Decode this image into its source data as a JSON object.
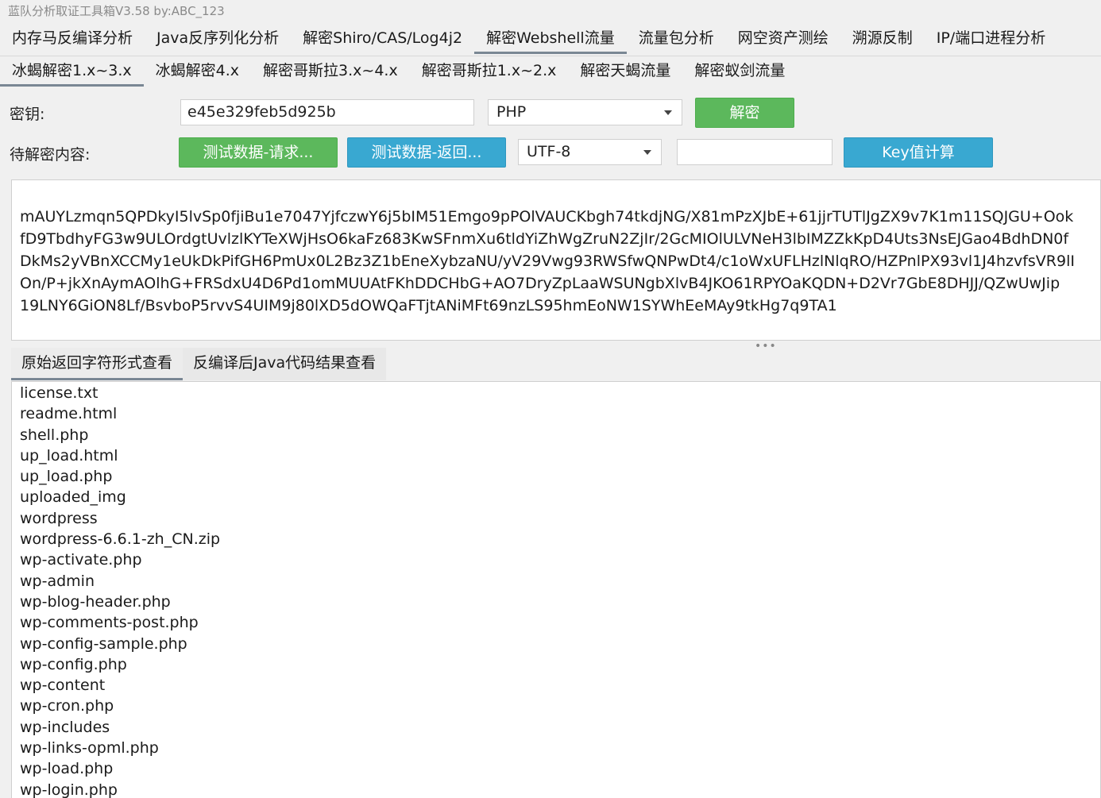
{
  "window": {
    "title": "蓝队分析取证工具箱V3.58 by:ABC_123"
  },
  "main_tabs": [
    {
      "label": "内存马反编译分析"
    },
    {
      "label": "Java反序列化分析"
    },
    {
      "label": "解密Shiro/CAS/Log4j2"
    },
    {
      "label": "解密Webshell流量",
      "active": true
    },
    {
      "label": "流量包分析"
    },
    {
      "label": "网空资产测绘"
    },
    {
      "label": "溯源反制"
    },
    {
      "label": "IP/端口进程分析"
    }
  ],
  "sub_tabs": [
    {
      "label": "冰蝎解密1.x~3.x",
      "active": true
    },
    {
      "label": "冰蝎解密4.x"
    },
    {
      "label": "解密哥斯拉3.x~4.x"
    },
    {
      "label": "解密哥斯拉1.x~2.x"
    },
    {
      "label": "解密天蝎流量"
    },
    {
      "label": "解密蚁剑流量"
    }
  ],
  "form": {
    "key_label": "密钥:",
    "key_value": "e45e329feb5d925b",
    "lang_select": "PHP",
    "decrypt_button": "解密",
    "content_label": "待解密内容:",
    "test_request_button": "测试数据-请求...",
    "test_response_button": "测试数据-返回...",
    "encoding_select": "UTF-8",
    "extra_input": "",
    "key_calc_button": "Key值计算"
  },
  "ciphertext": [
    "mAUYLzmqn5QPDkyI5lvSp0fjiBu1e7047YjfczwY6j5bIM51Emgo9pPOlVAUCKbgh74tkdjNG/X81mPzXJbE+61jjrTUTlJgZX9v7K1m11SQJGU+Ook",
    "fD9TbdhyFG3w9ULOrdgtUvlzlKYTeXWjHsO6kaFz683KwSFnmXu6tldYiZhWgZruN2ZjIr/2GcMIOlULVNeH3lbIMZZkKpD4Uts3NsEJGao4BdhDN0f",
    "DkMs2yVBnXCCMy1eUkDkPifGH6PmUx0L2Bz3Z1bEneXybzaNU/yV29Vwg93RWSfwQNPwDt4/c1oWxUFLHzlNlqRO/HZPnlPX93vl1J4hzvfsVR9lI",
    "On/P+jkXnAymAOlhG+FRSdxU4D6Pd1omMUUAtFKhDDCHbG+AO7DryZpLaaWSUNgbXlvB4JKO61RPYOaKQDN+D2Vr7GbE8DHJJ/QZwUwJip",
    "19LNY6GiON8Lf/BsvboP5rvvS4UIM9j80lXD5dOWQaFTjtANiMFt69nzLS95hmEoNW1SYWhEeMAy9tkHg7q9TA1"
  ],
  "result_tabs": [
    {
      "label": "原始返回字符形式查看",
      "active": true
    },
    {
      "label": "反编译后Java代码结果查看"
    }
  ],
  "result_lines": [
    "license.txt",
    "readme.html",
    "shell.php",
    "up_load.html",
    "up_load.php",
    "uploaded_img",
    "wordpress",
    "wordpress-6.6.1-zh_CN.zip",
    "wp-activate.php",
    "wp-admin",
    "wp-blog-header.php",
    "wp-comments-post.php",
    "wp-config-sample.php",
    "wp-config.php",
    "wp-content",
    "wp-cron.php",
    "wp-includes",
    "wp-links-opml.php",
    "wp-load.php",
    "wp-login.php"
  ],
  "colors": {
    "green_button": "#5cb85c",
    "blue_button": "#39a8d1",
    "active_tab_underline": "#7a8794"
  }
}
